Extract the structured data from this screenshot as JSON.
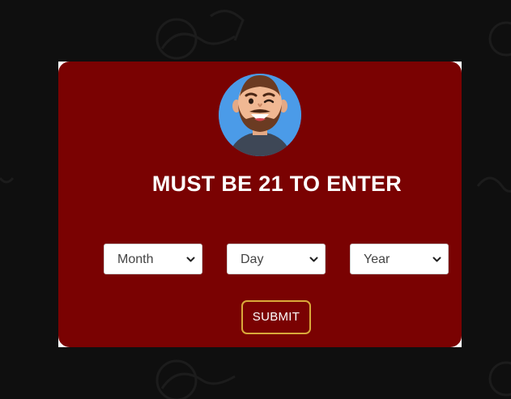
{
  "age_gate": {
    "title": "MUST BE 21 TO ENTER",
    "month_select": {
      "selected": "Month"
    },
    "day_select": {
      "selected": "Day"
    },
    "year_select": {
      "selected": "Year"
    },
    "submit_label": "SUBMIT"
  },
  "colors": {
    "modal_bg": "#7a0202",
    "page_bg": "#0f0f0f",
    "submit_border": "#d9a93a",
    "avatar_bg": "#4b9be8"
  },
  "icons": {
    "avatar": "winking-bearded-man-avatar",
    "select_arrow": "chevron-down-icon"
  }
}
